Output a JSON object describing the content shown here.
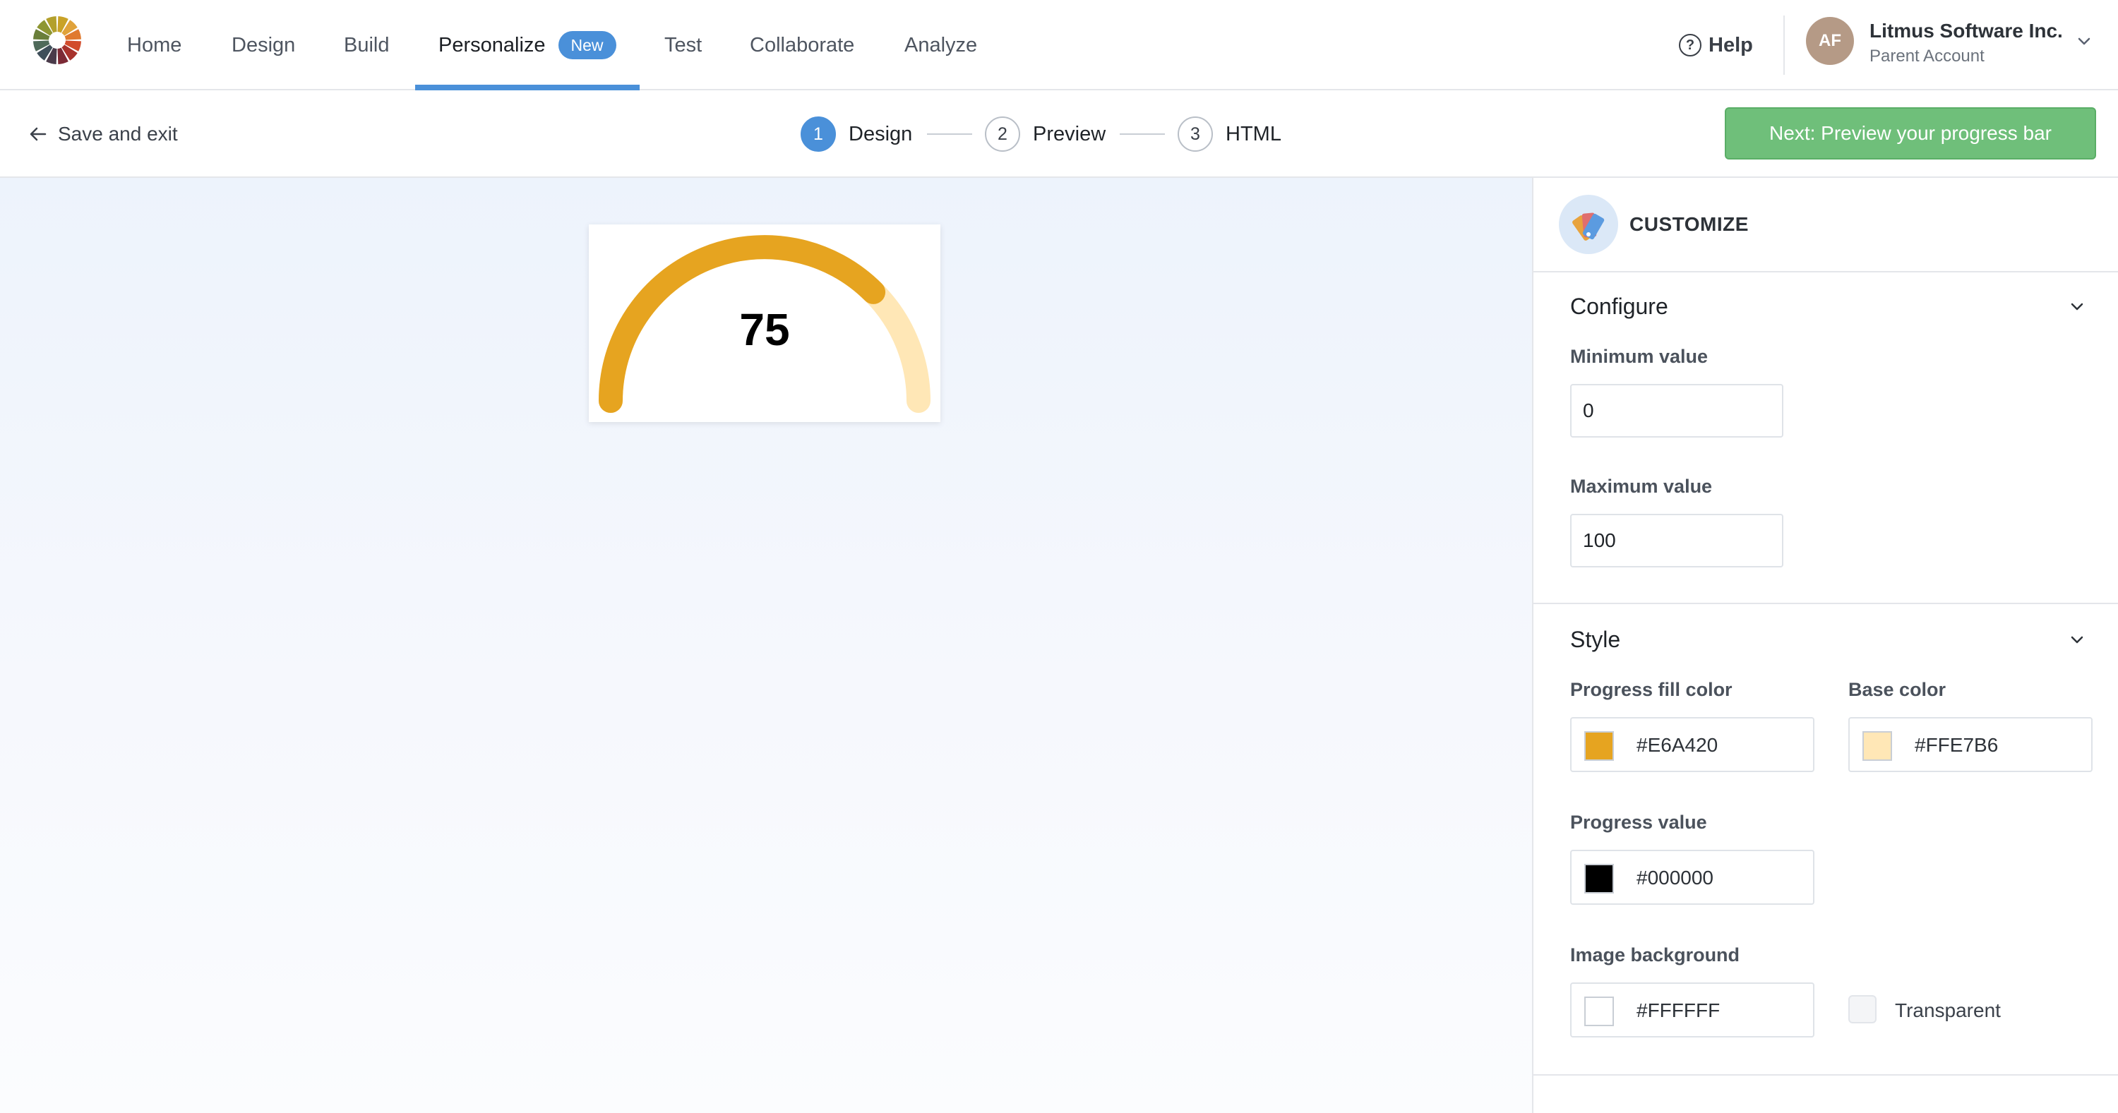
{
  "nav": {
    "items": [
      {
        "label": "Home"
      },
      {
        "label": "Design"
      },
      {
        "label": "Build"
      },
      {
        "label": "Personalize",
        "badge": "New",
        "active": true
      },
      {
        "label": "Test"
      },
      {
        "label": "Collaborate"
      },
      {
        "label": "Analyze"
      }
    ],
    "help_label": "Help",
    "account": {
      "initials": "AF",
      "name": "Litmus Software Inc.",
      "subtitle": "Parent Account"
    },
    "accent_color": "#4a90d9"
  },
  "stepbar": {
    "back_label": "Save and exit",
    "steps": [
      {
        "number": "1",
        "label": "Design",
        "current": true
      },
      {
        "number": "2",
        "label": "Preview"
      },
      {
        "number": "3",
        "label": "HTML"
      }
    ],
    "next_label": "Next: Preview your progress bar",
    "next_color": "#6fbf7a"
  },
  "preview": {
    "value": "75",
    "progress_fraction": 0.75,
    "fill_color": "#E6A420",
    "base_color": "#FFE7B6"
  },
  "panel": {
    "title": "CUSTOMIZE",
    "configure": {
      "title": "Configure",
      "min_label": "Minimum value",
      "min_value": "0",
      "max_label": "Maximum value",
      "max_value": "100"
    },
    "style": {
      "title": "Style",
      "fill_label": "Progress fill color",
      "fill_value": "#E6A420",
      "base_label": "Base color",
      "base_value": "#FFE7B6",
      "value_label": "Progress value",
      "value_color": "#000000",
      "bg_label": "Image background",
      "bg_value": "#FFFFFF",
      "transparent_label": "Transparent"
    }
  }
}
